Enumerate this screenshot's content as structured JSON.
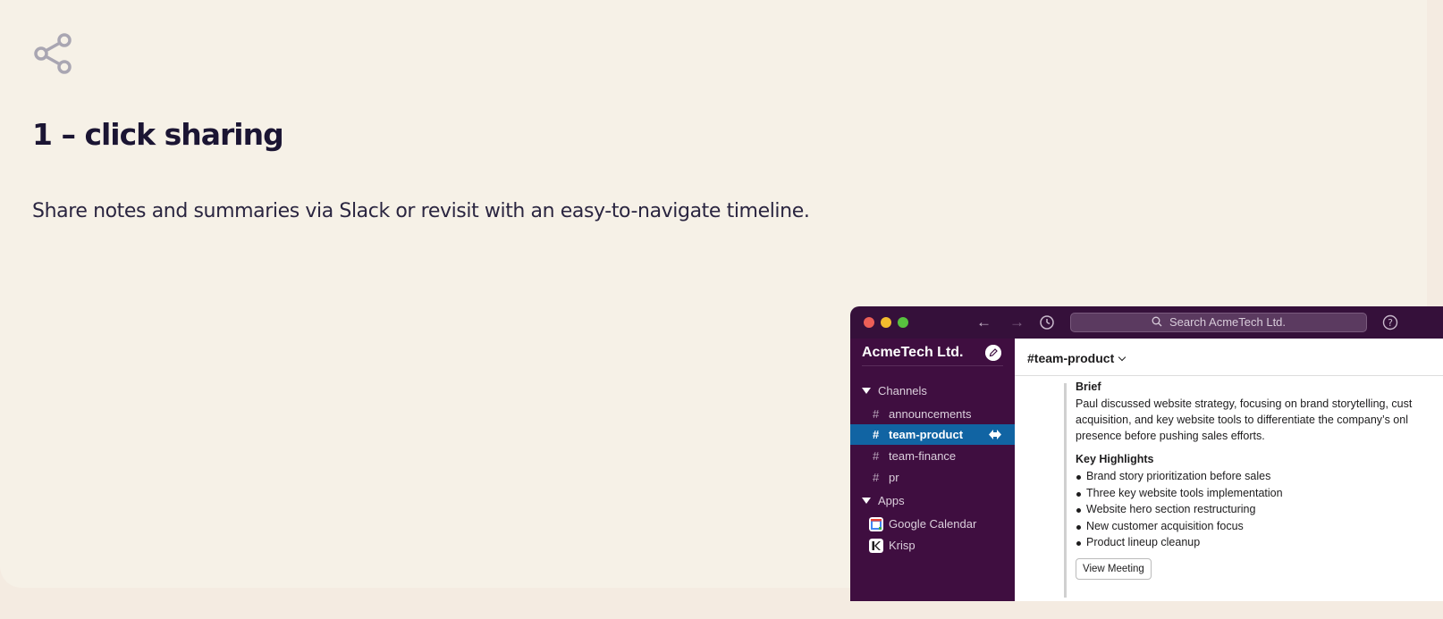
{
  "hero": {
    "icon": "share-icon",
    "title": "1 – click sharing",
    "subtitle": "Share notes and summaries via Slack or revisit with an easy-to-navigate timeline."
  },
  "slack": {
    "search_placeholder": "Search AcmeTech Ltd.",
    "workspace_name": "AcmeTech Ltd.",
    "sections": {
      "channels_label": "Channels",
      "apps_label": "Apps"
    },
    "channels": [
      {
        "name": "announcements"
      },
      {
        "name": "team-product"
      },
      {
        "name": "team-finance"
      },
      {
        "name": "pr"
      }
    ],
    "apps": [
      {
        "name": "Google Calendar"
      },
      {
        "name": "Krisp"
      }
    ],
    "active_channel_title": "#team-product",
    "message": {
      "brief_heading": "Brief",
      "brief_lines": [
        "Paul discussed website strategy, focusing on brand storytelling, cust",
        "acquisition, and key website tools to differentiate the company’s onl",
        "presence before pushing sales efforts."
      ],
      "highlights_heading": "Key Highlights",
      "highlights": [
        "Brand story prioritization before sales",
        "Three key website tools implementation",
        "Website hero section restructuring",
        "New customer acquisition focus",
        "Product lineup cleanup"
      ],
      "view_button": "View Meeting"
    },
    "colors": {
      "titlebar": "#35103a",
      "sidebar": "#3f0e40",
      "active_channel": "#1164a3"
    }
  }
}
